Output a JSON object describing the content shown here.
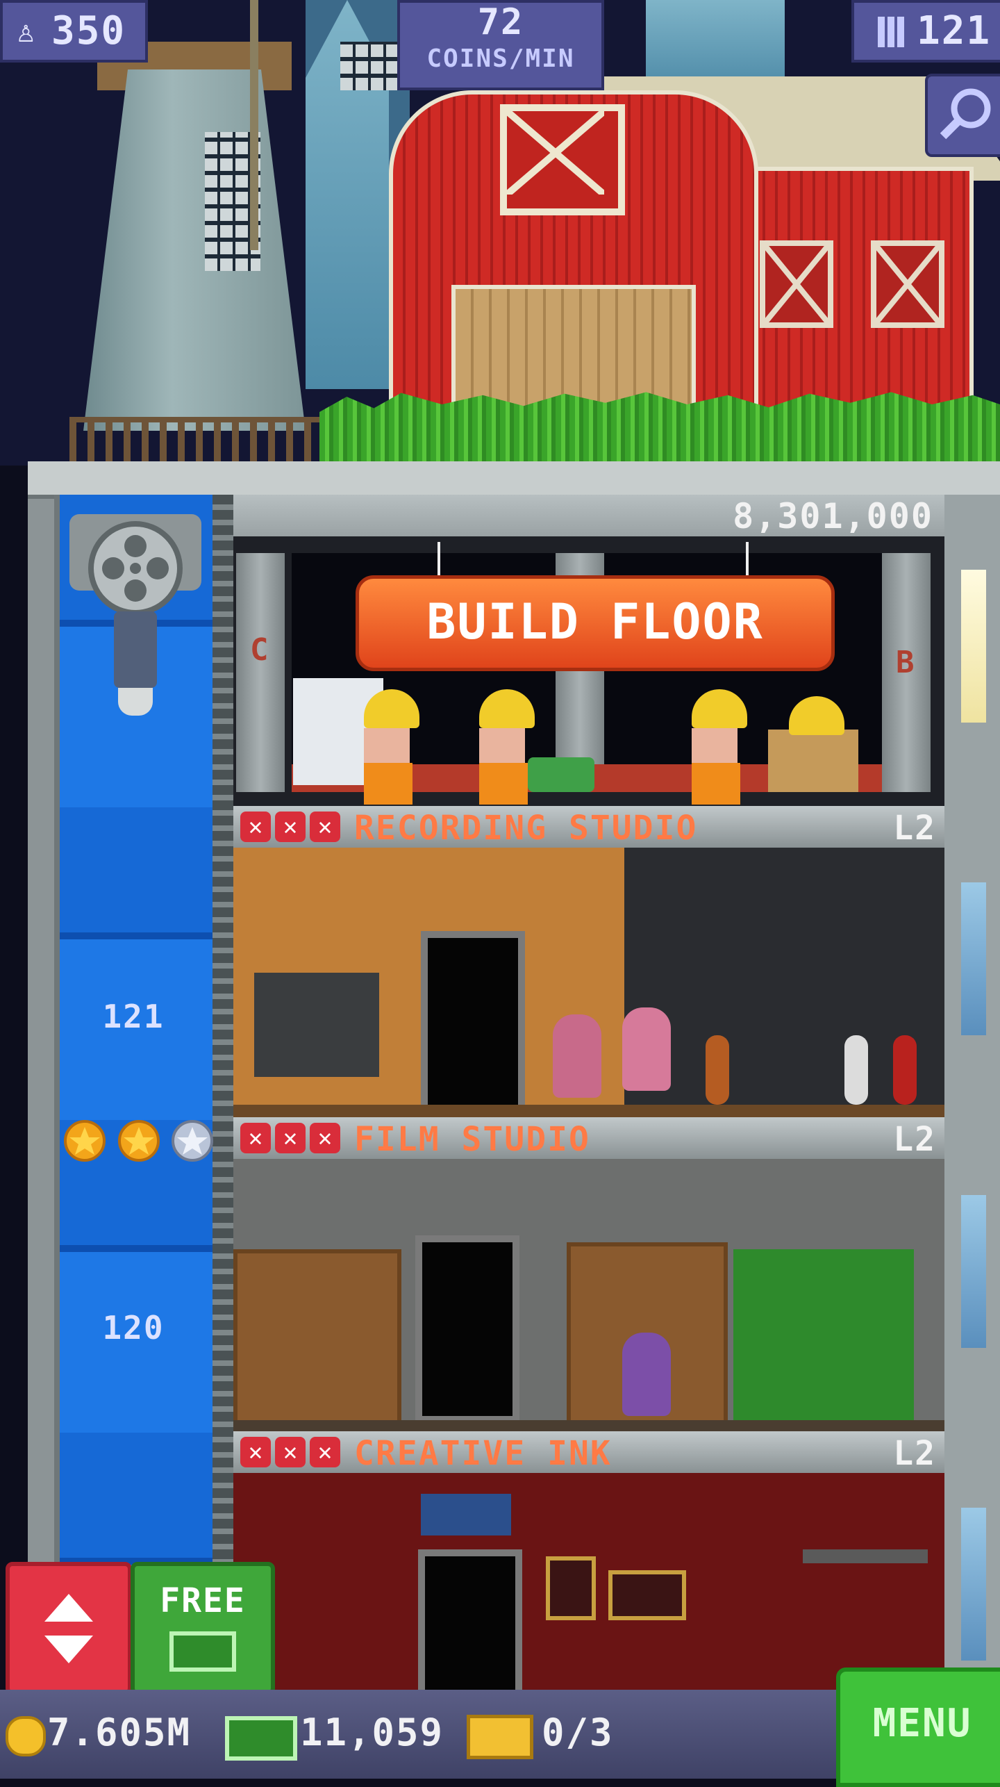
{
  "hud": {
    "population": "350",
    "coins_rate_value": "72",
    "coins_rate_unit": "COINS/MIN",
    "floors": "121"
  },
  "build": {
    "cost": "8,301,000",
    "button_label": "BUILD FLOOR"
  },
  "floors": [
    {
      "number": "121",
      "name": "RECORDING STUDIO",
      "level": "L2"
    },
    {
      "number": "120",
      "name": "FILM STUDIO",
      "level": "L2"
    },
    {
      "name": "CREATIVE INK",
      "level": "L2"
    }
  ],
  "elevator": {
    "stars_filled": 2,
    "stars_total": 3
  },
  "bottom": {
    "coins": "7.605M",
    "bux": "11,059",
    "vip": "0/3",
    "free_label": "FREE",
    "menu_label": "MENU"
  },
  "misc": {
    "building_letter_left": "C",
    "building_letter_right": "B"
  },
  "colors": {
    "accent_orange": "#ff7a45",
    "hud_purple": "#54569b",
    "menu_green": "#3fc23a"
  }
}
